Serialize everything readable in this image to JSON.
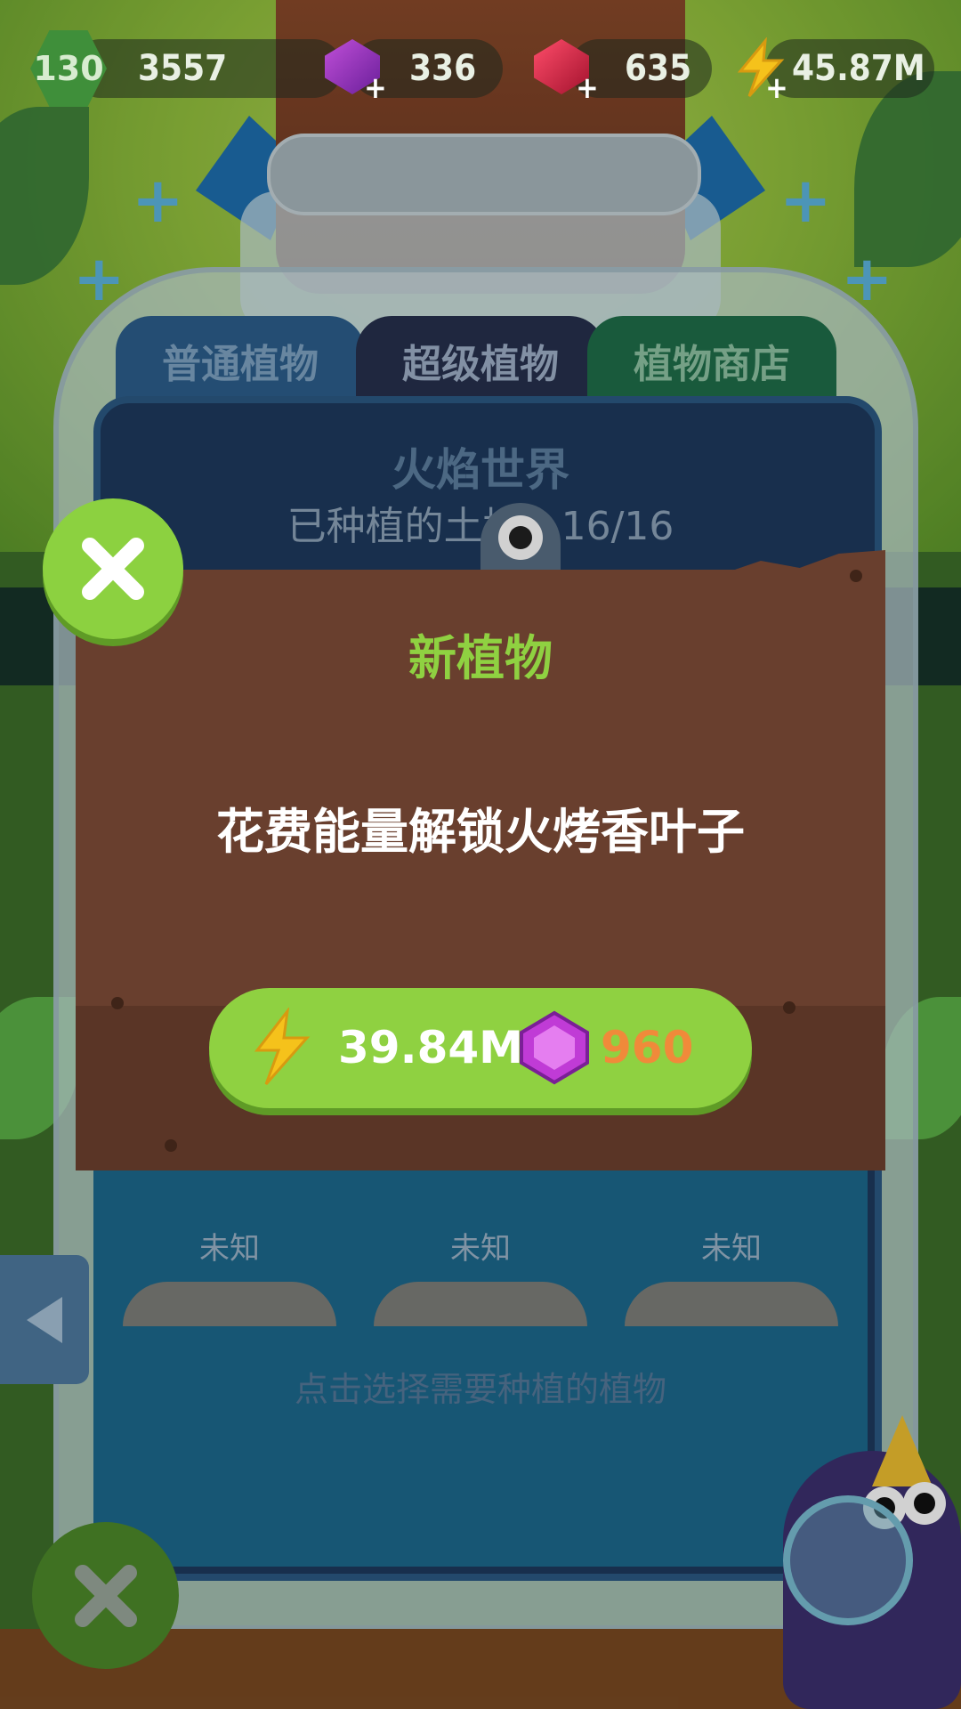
{
  "resources": {
    "level": "130",
    "xp": "3557",
    "gems": "336",
    "rubies": "635",
    "energy": "45.87M"
  },
  "tabs": [
    {
      "label": "普通植物"
    },
    {
      "label": "超级植物"
    },
    {
      "label": "植物商店"
    }
  ],
  "world": {
    "title": "火焰世界",
    "planted_label": "已种植的土地：16/16"
  },
  "slots": [
    {
      "label": "未知"
    },
    {
      "label": "未知"
    },
    {
      "label": "未知"
    }
  ],
  "hint": "点击选择需要种植的植物",
  "modal": {
    "title": "新植物",
    "message": "花费能量解锁火烤香叶子",
    "energy_cost": "39.84M",
    "gem_cost": "960"
  },
  "colors": {
    "accent_green": "#8fd141",
    "modal_brown": "#693f2e",
    "gem_cost_orange": "#f08a3a"
  },
  "icons": {
    "level": "level-hex-icon",
    "gem": "purple-gem-icon",
    "ruby": "red-ruby-icon",
    "energy": "lightning-icon",
    "close": "close-x-icon",
    "back": "left-arrow-icon"
  }
}
